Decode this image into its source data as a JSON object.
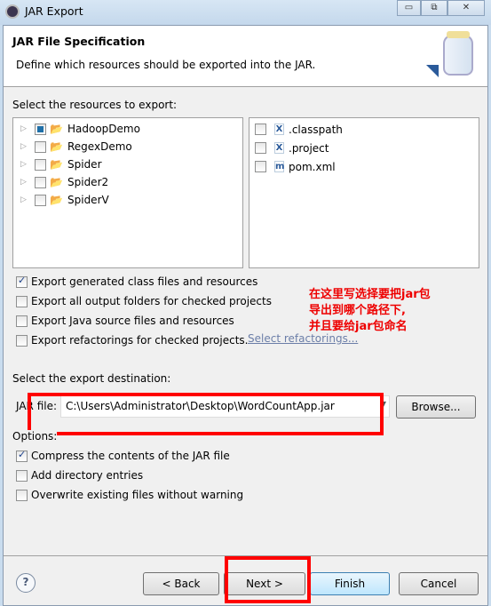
{
  "window": {
    "title": "JAR Export",
    "minimize": "▭",
    "maximize": "⧉",
    "close": "✕"
  },
  "header": {
    "title": "JAR File Specification",
    "description": "Define which resources should be exported into the JAR."
  },
  "resources": {
    "label": "Select the resources to export:",
    "projects": [
      {
        "name": "HadoopDemo",
        "state": "partial"
      },
      {
        "name": "RegexDemo",
        "state": "unchecked"
      },
      {
        "name": "Spider",
        "state": "unchecked"
      },
      {
        "name": "Spider2",
        "state": "unchecked"
      },
      {
        "name": "SpiderV",
        "state": "unchecked"
      }
    ],
    "files": [
      {
        "name": ".classpath",
        "icon": "X"
      },
      {
        "name": ".project",
        "icon": "X"
      },
      {
        "name": "pom.xml",
        "icon": "m"
      }
    ]
  },
  "export_options": [
    {
      "label": "Export generated class files and resources",
      "checked": true
    },
    {
      "label": "Export all output folders for checked projects",
      "checked": false
    },
    {
      "label": "Export Java source files and resources",
      "checked": false
    },
    {
      "label": "Export refactorings for checked projects.",
      "checked": false
    }
  ],
  "select_refactorings": "Select refactorings...",
  "annotation": [
    "在这里写选择要把jar包",
    "导出到哪个路径下,",
    "并且要给jar包命名"
  ],
  "destination": {
    "label": "Select the export destination:",
    "jar_label": "JAR file:",
    "jar_value": "C:\\Users\\Administrator\\Desktop\\WordCountApp.jar",
    "browse": "Browse..."
  },
  "options": {
    "label": "Options:",
    "items": [
      {
        "label": "Compress the contents of the JAR file",
        "checked": true
      },
      {
        "label": "Add directory entries",
        "checked": false
      },
      {
        "label": "Overwrite existing files without warning",
        "checked": false
      }
    ]
  },
  "buttons": {
    "help": "?",
    "back": "< Back",
    "next": "Next >",
    "finish": "Finish",
    "cancel": "Cancel"
  },
  "colors": {
    "annotation": "#ff0000"
  }
}
